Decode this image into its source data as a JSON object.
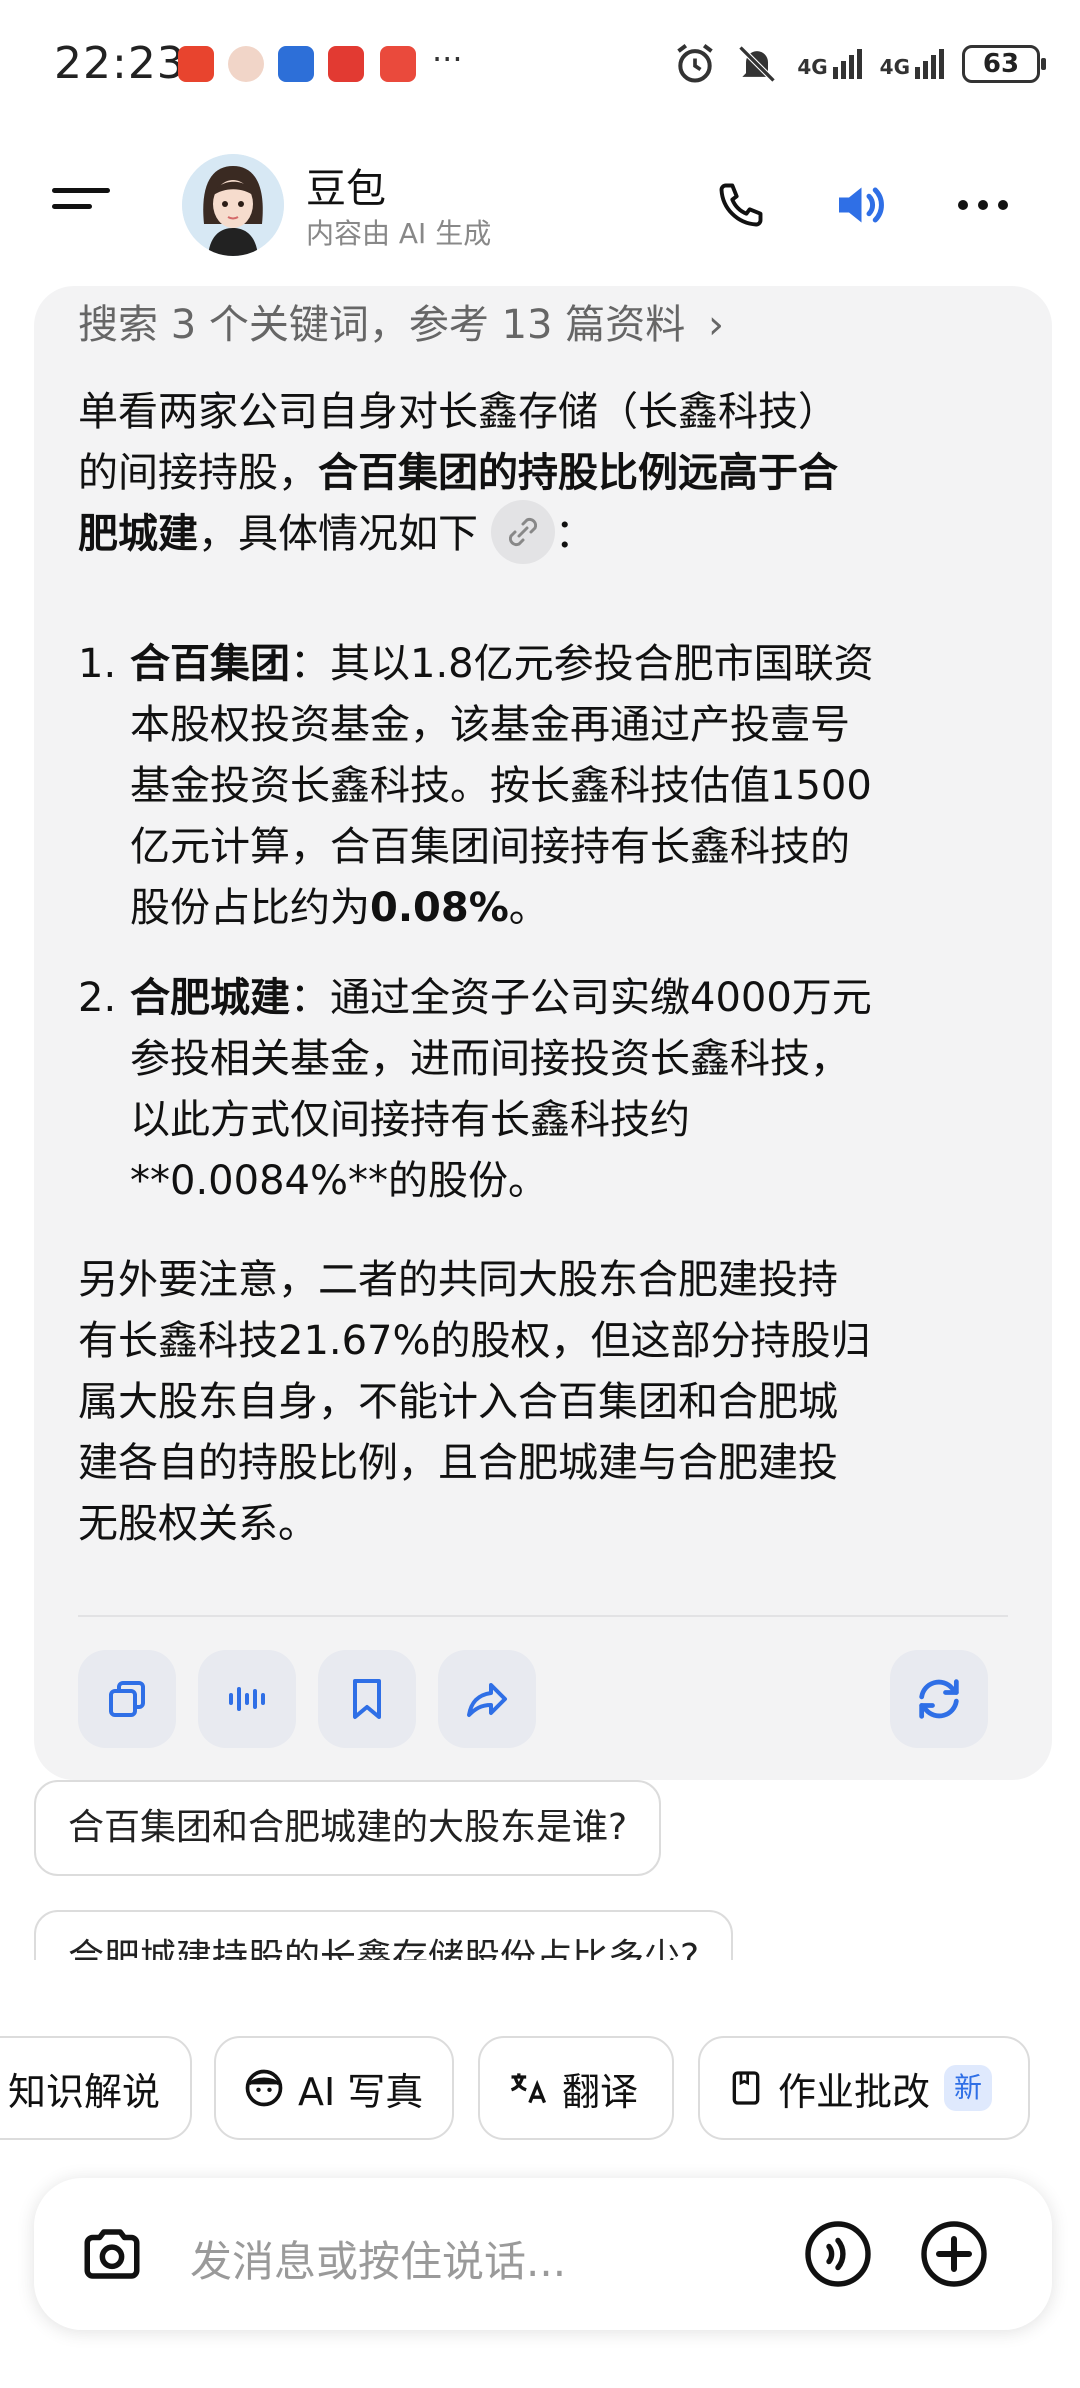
{
  "status_bar": {
    "time": "22:23",
    "battery": "63",
    "net1": "4G",
    "net2": "4G",
    "more": "···"
  },
  "header": {
    "name": "豆包",
    "subtitle": "内容由 AI 生成"
  },
  "answer": {
    "search_summary": "搜索 3 个关键词，参考 13 篇资料",
    "intro_a": "单看两家公司自身对长鑫存储（长鑫科技）",
    "intro_b1": "的间接持股，",
    "intro_b2": "合百集团的持股比例远高于合",
    "intro_c1": "肥城建",
    "intro_c2": "，具体情况如下",
    "intro_c3": "：",
    "items": [
      {
        "num": "1.",
        "head": "合百集团",
        "l1": "：其以1.8亿元参投合肥市国联资",
        "l2": "本股权投资基金，该基金再通过产投壹号",
        "l3": "基金投资长鑫科技。按长鑫科技估值1500",
        "l4": "亿元计算，合百集团间接持有长鑫科技的",
        "l5a": "股份占比约为",
        "l5b": "0.08%",
        "l5c": "。"
      },
      {
        "num": "2.",
        "head": "合肥城建",
        "l1": "：通过全资子公司实缴4000万元",
        "l2": "参投相关基金，进而间接投资长鑫科技，",
        "l3": "以此方式仅间接持有长鑫科技约",
        "l4": "**0.0084%**的股份。"
      }
    ],
    "note": [
      "另外要注意，二者的共同大股东合肥建投持",
      "有长鑫科技21.67%的股权，但这部分持股归",
      "属大股东自身，不能计入合百集团和合肥城",
      "建各自的持股比例，且合肥城建与合肥建投",
      "无股权关系。"
    ]
  },
  "suggestions": [
    "合百集团和合肥城建的大股东是谁?",
    "合肥城建持股的长鑫存储股份占比多少?"
  ],
  "tools": [
    {
      "label": "知识解说"
    },
    {
      "label": "AI 写真"
    },
    {
      "label": "翻译"
    },
    {
      "label": "作业批改",
      "badge": "新"
    }
  ],
  "input": {
    "placeholder": "发消息或按住说话..."
  },
  "colors": {
    "accent": "#2f6fe6",
    "card_bg": "#f3f3f4"
  }
}
